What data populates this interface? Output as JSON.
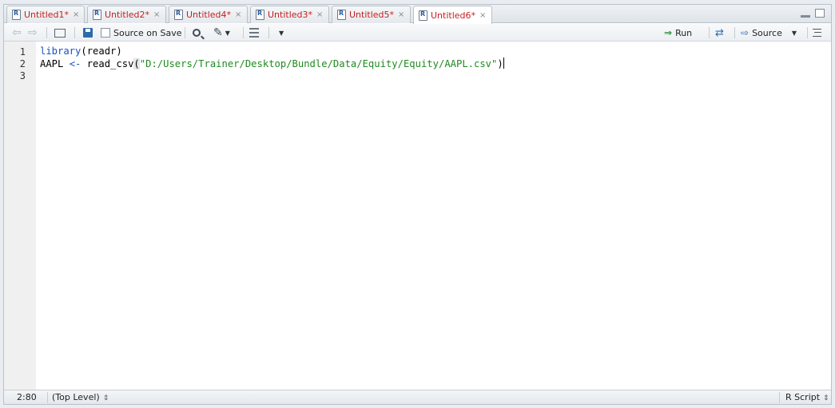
{
  "tabs": [
    {
      "label": "Untitled1*",
      "active": false
    },
    {
      "label": "Untitled2*",
      "active": false
    },
    {
      "label": "Untitled4*",
      "active": false
    },
    {
      "label": "Untitled3*",
      "active": false
    },
    {
      "label": "Untitled5*",
      "active": false
    },
    {
      "label": "Untitled6*",
      "active": true
    }
  ],
  "tab_close_glyph": "×",
  "toolbar": {
    "source_on_save_label": "Source on Save",
    "source_on_save_checked": false,
    "run_label": "Run",
    "source_label": "Source"
  },
  "editor": {
    "line_numbers": [
      "1",
      "2",
      "3"
    ],
    "lines": {
      "l1_func": "library",
      "l1_rest": "(readr)",
      "l2_var": "AAPL ",
      "l2_op": "<-",
      "l2_func": " read_csv",
      "l2_open": "(",
      "l2_str": "\"D:/Users/Trainer/Desktop/Bundle/Data/Equity/Equity/AAPL.csv\"",
      "l2_close": ")"
    }
  },
  "status": {
    "cursor_position": "2:80",
    "scope": "(Top Level)",
    "file_type": "R Script"
  },
  "colors": {
    "tab_text": "#c81e1e",
    "keyword": "#1a4fc4",
    "string": "#1f8a1f"
  }
}
